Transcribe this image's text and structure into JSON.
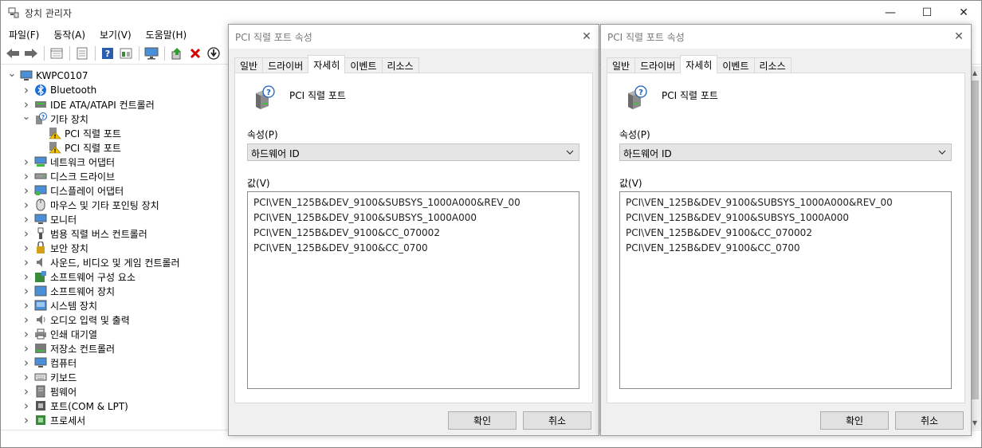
{
  "main_window": {
    "title": "장치 관리자",
    "controls": {
      "minimize": "—",
      "maximize": "☐",
      "close": "✕"
    },
    "menu": [
      "파일(F)",
      "동작(A)",
      "보기(V)",
      "도움말(H)"
    ],
    "toolbar_icons": [
      "back-arrow-icon",
      "forward-arrow-icon",
      "show-hidden-icon",
      "properties-icon",
      "help-icon",
      "view-icon",
      "monitor-icon",
      "update-driver-icon",
      "uninstall-icon",
      "enable-device-icon"
    ],
    "tree": [
      {
        "label": "KWPC0107",
        "level": 0,
        "expander": "down",
        "icon": "computer-icon"
      },
      {
        "label": "Bluetooth",
        "level": 1,
        "expander": "right",
        "icon": "bluetooth-icon"
      },
      {
        "label": "IDE ATA/ATAPI 컨트롤러",
        "level": 1,
        "expander": "right",
        "icon": "ide-controller-icon"
      },
      {
        "label": "기타 장치",
        "level": 1,
        "expander": "down",
        "icon": "other-devices-icon"
      },
      {
        "label": "PCI 직렬 포트",
        "level": 2,
        "expander": "none",
        "icon": "warning-device-icon"
      },
      {
        "label": "PCI 직렬 포트",
        "level": 2,
        "expander": "none",
        "icon": "warning-device-icon"
      },
      {
        "label": "네트워크 어댑터",
        "level": 1,
        "expander": "right",
        "icon": "network-adapter-icon"
      },
      {
        "label": "디스크 드라이브",
        "level": 1,
        "expander": "right",
        "icon": "disk-drive-icon"
      },
      {
        "label": "디스플레이 어댑터",
        "level": 1,
        "expander": "right",
        "icon": "display-adapter-icon"
      },
      {
        "label": "마우스 및 기타 포인팅 장치",
        "level": 1,
        "expander": "right",
        "icon": "mouse-icon"
      },
      {
        "label": "모니터",
        "level": 1,
        "expander": "right",
        "icon": "monitor-icon"
      },
      {
        "label": "범용 직렬 버스 컨트롤러",
        "level": 1,
        "expander": "right",
        "icon": "usb-icon"
      },
      {
        "label": "보안 장치",
        "level": 1,
        "expander": "right",
        "icon": "security-device-icon"
      },
      {
        "label": "사운드, 비디오 및 게임 컨트롤러",
        "level": 1,
        "expander": "right",
        "icon": "sound-icon"
      },
      {
        "label": "소프트웨어 구성 요소",
        "level": 1,
        "expander": "right",
        "icon": "software-component-icon"
      },
      {
        "label": "소프트웨어 장치",
        "level": 1,
        "expander": "right",
        "icon": "software-device-icon"
      },
      {
        "label": "시스템 장치",
        "level": 1,
        "expander": "right",
        "icon": "system-device-icon"
      },
      {
        "label": "오디오 입력 및 출력",
        "level": 1,
        "expander": "right",
        "icon": "audio-io-icon"
      },
      {
        "label": "인쇄 대기열",
        "level": 1,
        "expander": "right",
        "icon": "printer-icon"
      },
      {
        "label": "저장소 컨트롤러",
        "level": 1,
        "expander": "right",
        "icon": "storage-controller-icon"
      },
      {
        "label": "컴퓨터",
        "level": 1,
        "expander": "right",
        "icon": "computer-icon"
      },
      {
        "label": "키보드",
        "level": 1,
        "expander": "right",
        "icon": "keyboard-icon"
      },
      {
        "label": "펌웨어",
        "level": 1,
        "expander": "right",
        "icon": "firmware-icon"
      },
      {
        "label": "포트(COM & LPT)",
        "level": 1,
        "expander": "right",
        "icon": "port-icon"
      },
      {
        "label": "프로세서",
        "level": 1,
        "expander": "right",
        "icon": "processor-icon"
      }
    ]
  },
  "dialog_left": {
    "title": "PCI 직렬 포트 속성",
    "close": "✕",
    "tabs": [
      "일반",
      "드라이버",
      "자세히",
      "이벤트",
      "리소스"
    ],
    "active_tab": "자세히",
    "device_name": "PCI 직렬 포트",
    "property_label": "속성(P)",
    "property_value": "하드웨어 ID",
    "value_label": "값(V)",
    "values": [
      "PCI\\VEN_125B&DEV_9100&SUBSYS_1000A000&REV_00",
      "PCI\\VEN_125B&DEV_9100&SUBSYS_1000A000",
      "PCI\\VEN_125B&DEV_9100&CC_070002",
      "PCI\\VEN_125B&DEV_9100&CC_0700"
    ],
    "ok": "확인",
    "cancel": "취소"
  },
  "dialog_right": {
    "title": "PCI 직렬 포트 속성",
    "close": "✕",
    "tabs": [
      "일반",
      "드라이버",
      "자세히",
      "이벤트",
      "리소스"
    ],
    "active_tab": "자세히",
    "device_name": "PCI 직렬 포트",
    "property_label": "속성(P)",
    "property_value": "하드웨어 ID",
    "value_label": "값(V)",
    "values": [
      "PCI\\VEN_125B&DEV_9100&SUBSYS_1000A000&REV_00",
      "PCI\\VEN_125B&DEV_9100&SUBSYS_1000A000",
      "PCI\\VEN_125B&DEV_9100&CC_070002",
      "PCI\\VEN_125B&DEV_9100&CC_0700"
    ],
    "ok": "확인",
    "cancel": "취소"
  },
  "colors": {
    "accent": "#0078d7",
    "warning": "#f2c200",
    "error": "#d00000"
  }
}
